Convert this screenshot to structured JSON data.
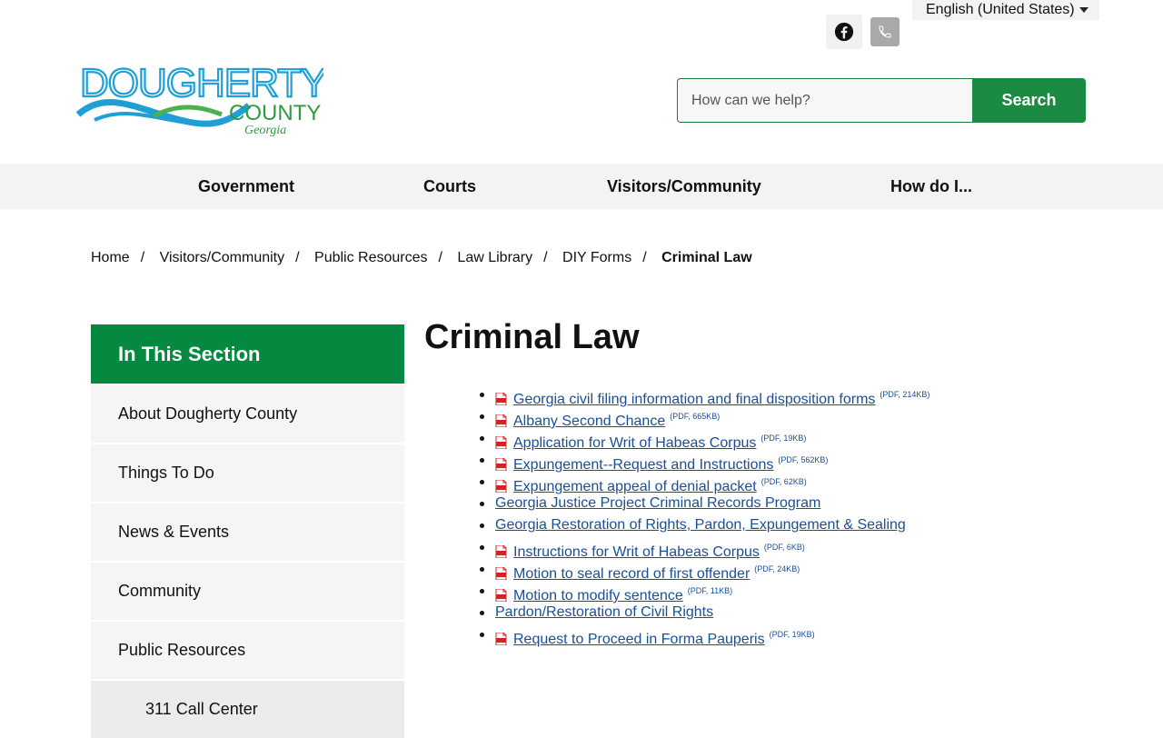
{
  "header": {
    "language": "English (United States)",
    "search_placeholder": "How can we help?",
    "search_button": "Search",
    "logo_text_1": "DOUGHERTY",
    "logo_text_2": "COUNTY",
    "logo_text_3": "Georgia",
    "social_icons": [
      "facebook-icon",
      "phone-icon"
    ],
    "colors": {
      "brand_green": "#05883f",
      "logo_blue": "#1e9fd6",
      "link_blue": "#1a4f98"
    }
  },
  "nav": {
    "items": [
      {
        "label": "Government"
      },
      {
        "label": "Courts"
      },
      {
        "label": "Visitors/Community"
      },
      {
        "label": "How do I..."
      }
    ]
  },
  "breadcrumb": {
    "items": [
      "Home",
      "Visitors/Community",
      "Public Resources",
      "Law Library",
      "DIY Forms"
    ],
    "current": "Criminal Law"
  },
  "sidebar": {
    "heading": "In This Section",
    "items": [
      {
        "label": "About Dougherty County"
      },
      {
        "label": "Things To Do"
      },
      {
        "label": "News & Events"
      },
      {
        "label": "Community"
      },
      {
        "label": "Public Resources"
      },
      {
        "label": "311 Call Center"
      }
    ]
  },
  "main": {
    "title": "Criminal Law",
    "documents": [
      {
        "label": "Georgia civil filing information and final disposition forms",
        "meta": "(PDF, 214KB)",
        "pdf": true
      },
      {
        "label": "Albany Second Chance",
        "meta": "(PDF, 665KB)",
        "pdf": true
      },
      {
        "label": "Application for Writ of Habeas Corpus",
        "meta": "(PDF, 19KB)",
        "pdf": true
      },
      {
        "label": "Expungement--Request and Instructions",
        "meta": "(PDF, 562KB)",
        "pdf": true
      },
      {
        "label": "Expungement appeal of denial packet",
        "meta": "(PDF, 62KB)",
        "pdf": true
      },
      {
        "label": "Georgia Justice Project Criminal Records Program",
        "meta": "",
        "pdf": false
      },
      {
        "label": "Georgia Restoration of Rights, Pardon, Expungement & Sealing",
        "meta": "",
        "pdf": false
      },
      {
        "label": "Instructions for Writ of Habeas Corpus",
        "meta": "(PDF, 6KB)",
        "pdf": true
      },
      {
        "label": "Motion to seal record of first offender",
        "meta": "(PDF, 24KB)",
        "pdf": true
      },
      {
        "label": "Motion to modify sentence",
        "meta": "(PDF, 11KB)",
        "pdf": true
      },
      {
        "label": "Pardon/Restoration of Civil Rights",
        "meta": "",
        "pdf": false
      },
      {
        "label": "Request to Proceed in Forma Pauperis",
        "meta": "(PDF, 19KB)",
        "pdf": true
      }
    ]
  }
}
